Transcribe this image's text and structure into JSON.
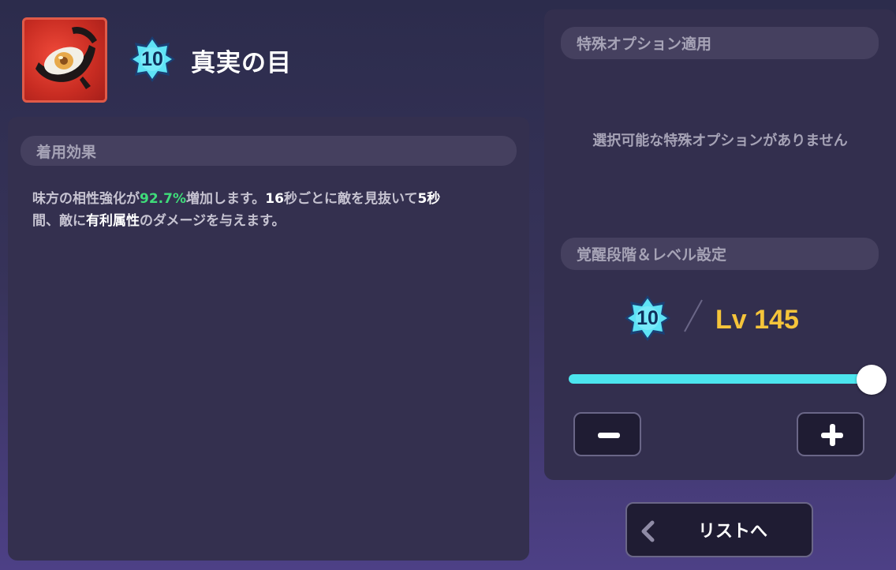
{
  "item": {
    "icon": "eye-gem-icon",
    "awakening": "10",
    "name": "真実の目"
  },
  "effect": {
    "header": "着用効果",
    "text": {
      "p1": "味方の相性強化が",
      "p2": "92.7%",
      "p3": "増加します。",
      "p4": "16",
      "p5": "秒ごとに敵を見抜いて",
      "p6": "5秒",
      "p7": "間、敵に",
      "p8": "有利属性",
      "p9": "のダメージを与えます。"
    }
  },
  "special": {
    "header": "特殊オプション適用",
    "empty_message": "選択可能な特殊オプションがありません"
  },
  "level": {
    "header": "覚醒段階＆レベル設定",
    "awakening": "10",
    "value": "Lv 145",
    "slider_fraction": 1.0
  },
  "back": {
    "label": "リストへ"
  },
  "colors": {
    "accent_green": "#3fdc7a",
    "level_gold": "#f5c43a",
    "slider_cyan": "#4ce5ee",
    "badge_cyan": "#5ee3f5"
  }
}
